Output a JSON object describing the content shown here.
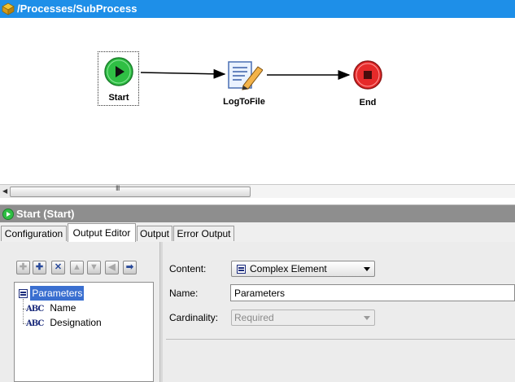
{
  "process": {
    "path": "/Processes/SubProcess"
  },
  "diagram": {
    "nodes": [
      {
        "id": "start",
        "label": "Start"
      },
      {
        "id": "log",
        "label": "LogToFile"
      },
      {
        "id": "end",
        "label": "End"
      }
    ]
  },
  "scrollbar": {
    "grip": "III"
  },
  "panel": {
    "title": "Start (Start)"
  },
  "tabs": [
    "Configuration",
    "Output Editor",
    "Output",
    "Error Output"
  ],
  "active_tab": "Output Editor",
  "tree": {
    "root": "Parameters",
    "children": [
      "Name",
      "Designation"
    ]
  },
  "form": {
    "content_label": "Content:",
    "content_value": "Complex Element",
    "name_label": "Name:",
    "name_value": "Parameters",
    "cardinality_label": "Cardinality:",
    "cardinality_value": "Required"
  },
  "icons": {
    "toolbar": [
      "add-icon",
      "add-child-icon",
      "delete-icon",
      "move-up-icon",
      "move-down-icon",
      "move-left-icon",
      "move-right-icon"
    ]
  },
  "colors": {
    "title_bar": "#1e8fe8",
    "panel_bar": "#8e8e8e",
    "selection": "#3a6fd0",
    "start_node": "#2fbf44",
    "end_node": "#e62a2a"
  }
}
